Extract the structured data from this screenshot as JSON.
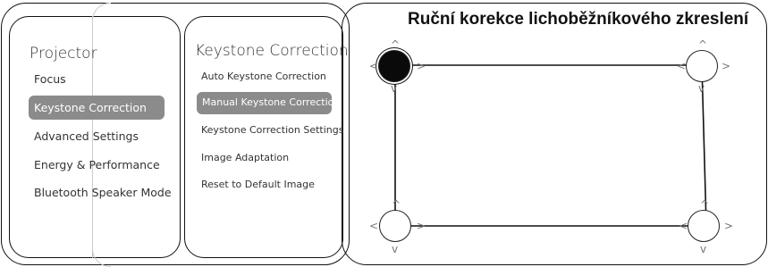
{
  "projector_menu": {
    "title": "Projector",
    "items": [
      {
        "label": "Focus",
        "selected": false
      },
      {
        "label": "Keystone Correction",
        "selected": true
      },
      {
        "label": "Advanced Settings",
        "selected": false
      },
      {
        "label": "Energy & Performance",
        "selected": false
      },
      {
        "label": "Bluetooth Speaker Mode",
        "selected": false
      }
    ]
  },
  "keystone_menu": {
    "title": "Keystone Correction",
    "items": [
      {
        "label": "Auto Keystone Correction",
        "selected": false
      },
      {
        "label": "Manual Keystone Correction",
        "selected": true
      },
      {
        "label": "Keystone Correction Settings",
        "selected": false
      },
      {
        "label": "Image Adaptation",
        "selected": false
      },
      {
        "label": "Reset to Default Image",
        "selected": false
      }
    ]
  },
  "manual_correction": {
    "title": "Ruční korekce lichoběžníkového zkreslení",
    "active_corner": "top-left",
    "arrow_glyphs": {
      "up": "^",
      "down": "v",
      "left": "<",
      "right": ">"
    }
  },
  "colors": {
    "selected_bg": "#8b8b8b",
    "selected_text": "#ffffff",
    "outline": "#111111",
    "active_handle": "#0a0a0a"
  }
}
